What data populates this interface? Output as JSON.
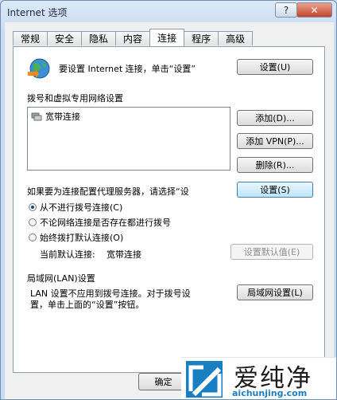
{
  "window": {
    "title": "Internet 选项",
    "help_label": "?",
    "close_label": "✕"
  },
  "tabs": [
    {
      "label": "常规",
      "active": false
    },
    {
      "label": "安全",
      "active": false
    },
    {
      "label": "隐私",
      "active": false
    },
    {
      "label": "内容",
      "active": false
    },
    {
      "label": "连接",
      "active": true
    },
    {
      "label": "程序",
      "active": false
    },
    {
      "label": "高级",
      "active": false
    }
  ],
  "connection": {
    "setup_text": "要设置 Internet 连接，单击“设置”",
    "setup_button": "设置(U)",
    "dialup_heading": "拨号和虚拟专用网络设置",
    "connections": [
      "宽带连接"
    ],
    "add_button": "添加(D)...",
    "add_vpn_button": "添加 VPN(P)...",
    "remove_button": "删除(R)...",
    "proxy_text": "如果要为连接配置代理服务器，请选择“设",
    "settings_button": "设置(S)",
    "radio_options": [
      {
        "label": "从不进行拨号连接(C)",
        "checked": true
      },
      {
        "label": "不论网络连接是否存在都进行拨号",
        "checked": false
      },
      {
        "label": "始终拨打默认连接(O)",
        "checked": false
      }
    ],
    "default_label": "当前默认连接:",
    "default_value": "宽带连接",
    "set_default_button": "设置默认值(E)",
    "lan_heading": "局域网(LAN)设置",
    "lan_text_line1": "LAN 设置不应用到拨号连接。对于拨号设",
    "lan_text_line2": "置，单击上面的“设置”按钮。",
    "lan_button": "局域网设置(L)"
  },
  "footer": {
    "ok_button": "确定"
  },
  "watermark": {
    "brand": "爱纯净",
    "domain": "aichunjing.com"
  },
  "colors": {
    "title_gradient_top": "#dce9f7",
    "close_red": "#c4442b",
    "focus_blue": "#3c7fb1",
    "watermark_blue": "#1a7ec2"
  }
}
